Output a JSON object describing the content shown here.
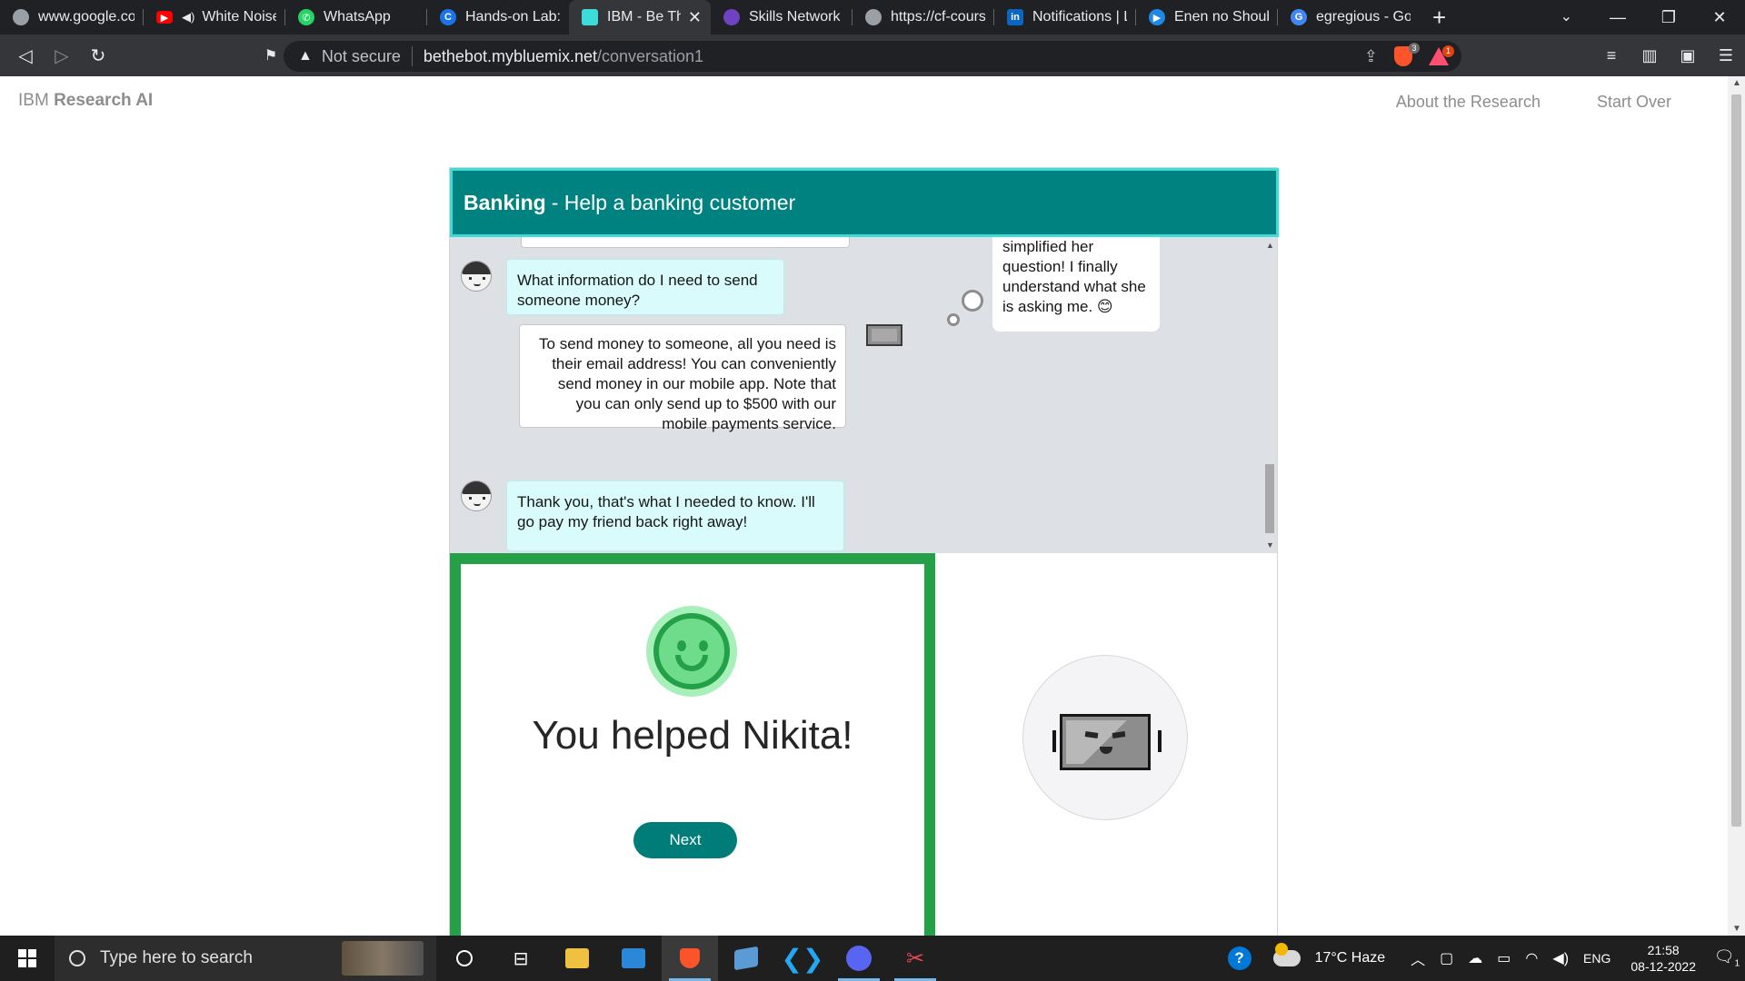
{
  "browser": {
    "tabs": [
      {
        "title": "www.google.com",
        "icon": "globe-icon",
        "color": "#9aa0a6"
      },
      {
        "title": "White Noise",
        "icon": "youtube-icon",
        "color": "#ff0000",
        "muted": true
      },
      {
        "title": "WhatsApp",
        "icon": "whatsapp-icon",
        "color": "#25d366"
      },
      {
        "title": "Hands-on Lab: P",
        "icon": "coursera-icon",
        "color": "#1a73e8"
      },
      {
        "title": "IBM - Be The",
        "icon": "ibm-bot-icon",
        "color": "#3ddbd9",
        "active": true
      },
      {
        "title": "Skills Network Ed",
        "icon": "skills-network-icon",
        "color": "#6f42c1"
      },
      {
        "title": "https://cf-course",
        "icon": "globe-icon",
        "color": "#9aa0a6"
      },
      {
        "title": "Notifications | Lin",
        "icon": "linkedin-icon",
        "color": "#0a66c2"
      },
      {
        "title": "Enen no Shoubo",
        "icon": "play-icon",
        "color": "#1e88e5"
      },
      {
        "title": "egregious - Goo",
        "icon": "google-icon",
        "color": "#4285f4"
      }
    ],
    "security_label": "Not secure",
    "url_host": "bethebot.mybluemix.net",
    "url_path": "/conversation1",
    "brave_shield_count": "3",
    "rewards_count": "1"
  },
  "site": {
    "brand_prefix": "IBM",
    "brand_suffix": "Research AI",
    "nav": [
      "About the Research",
      "Start Over"
    ]
  },
  "panel": {
    "title_bold": "Banking",
    "title_rest": "- Help a banking customer"
  },
  "chat": {
    "thought_text": "simplified her question! I finally understand what she is asking me. 😊",
    "messages": [
      {
        "from": "user",
        "text": "What information do I need to send someone money?"
      },
      {
        "from": "bot",
        "text": "To send money to someone, all you need is their email address! You can conveniently send money in our mobile app. Note that you can only send up to $500 with our mobile payments service."
      },
      {
        "from": "user",
        "text": "Thank you, that's what I needed to know. I'll go pay my friend back right away!"
      }
    ]
  },
  "result": {
    "title": "You helped Nikita!",
    "next_label": "Next"
  },
  "taskbar": {
    "search_placeholder": "Type here to search",
    "apps": [
      "file-explorer-icon",
      "mail-icon",
      "brave-icon",
      "remote-desktop-icon",
      "vscode-icon",
      "discord-icon",
      "snipping-tool-icon"
    ],
    "weather": "17°C  Haze",
    "language": "ENG",
    "time": "21:58",
    "date": "08-12-2022",
    "notification_count": "1"
  },
  "colors": {
    "accent_teal": "#008280",
    "success_green": "#24a148",
    "user_bubble": "#d9fbfb",
    "chat_bg": "#dde1e6"
  }
}
